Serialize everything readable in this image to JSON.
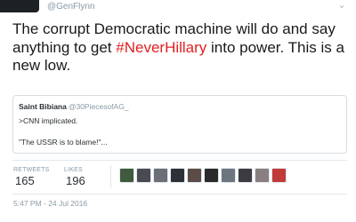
{
  "tweet": {
    "handle": "@GenFlynn",
    "text_part1": "The corrupt Democratic machine will do and say anything to get ",
    "hashtag": "#NeverHillary",
    "text_part2": " into power. This is a new low.",
    "colors": {
      "hashtag": "#e02020",
      "secondary_text": "#8899a6"
    }
  },
  "quoted_tweet": {
    "name": "Saint Bibiana",
    "handle": "@30PiecesofAG_",
    "line1": ">CNN implicated.",
    "line2": "\"The USSR is to blame!\"..."
  },
  "stats": {
    "retweets_label": "RETWEETS",
    "retweets_value": "165",
    "likes_label": "LIKES",
    "likes_value": "196"
  },
  "liker_avatars": [
    {
      "name": "liker-avatar-1",
      "color": "#3f5a3c"
    },
    {
      "name": "liker-avatar-2",
      "color": "#4a4a52"
    },
    {
      "name": "liker-avatar-3",
      "color": "#6b6f78"
    },
    {
      "name": "liker-avatar-4",
      "color": "#2d3036"
    },
    {
      "name": "liker-avatar-5",
      "color": "#5c4b47"
    },
    {
      "name": "liker-avatar-6",
      "color": "#2a2a2a"
    },
    {
      "name": "liker-avatar-7",
      "color": "#6d7580"
    },
    {
      "name": "liker-avatar-8",
      "color": "#3b3b40"
    },
    {
      "name": "liker-avatar-9",
      "color": "#8a7f80"
    },
    {
      "name": "liker-avatar-10",
      "color": "#c23b3b"
    }
  ],
  "timestamp": "5:47 PM - 24 Jul 2016",
  "icons": {
    "caret": "chevron-down-icon"
  }
}
